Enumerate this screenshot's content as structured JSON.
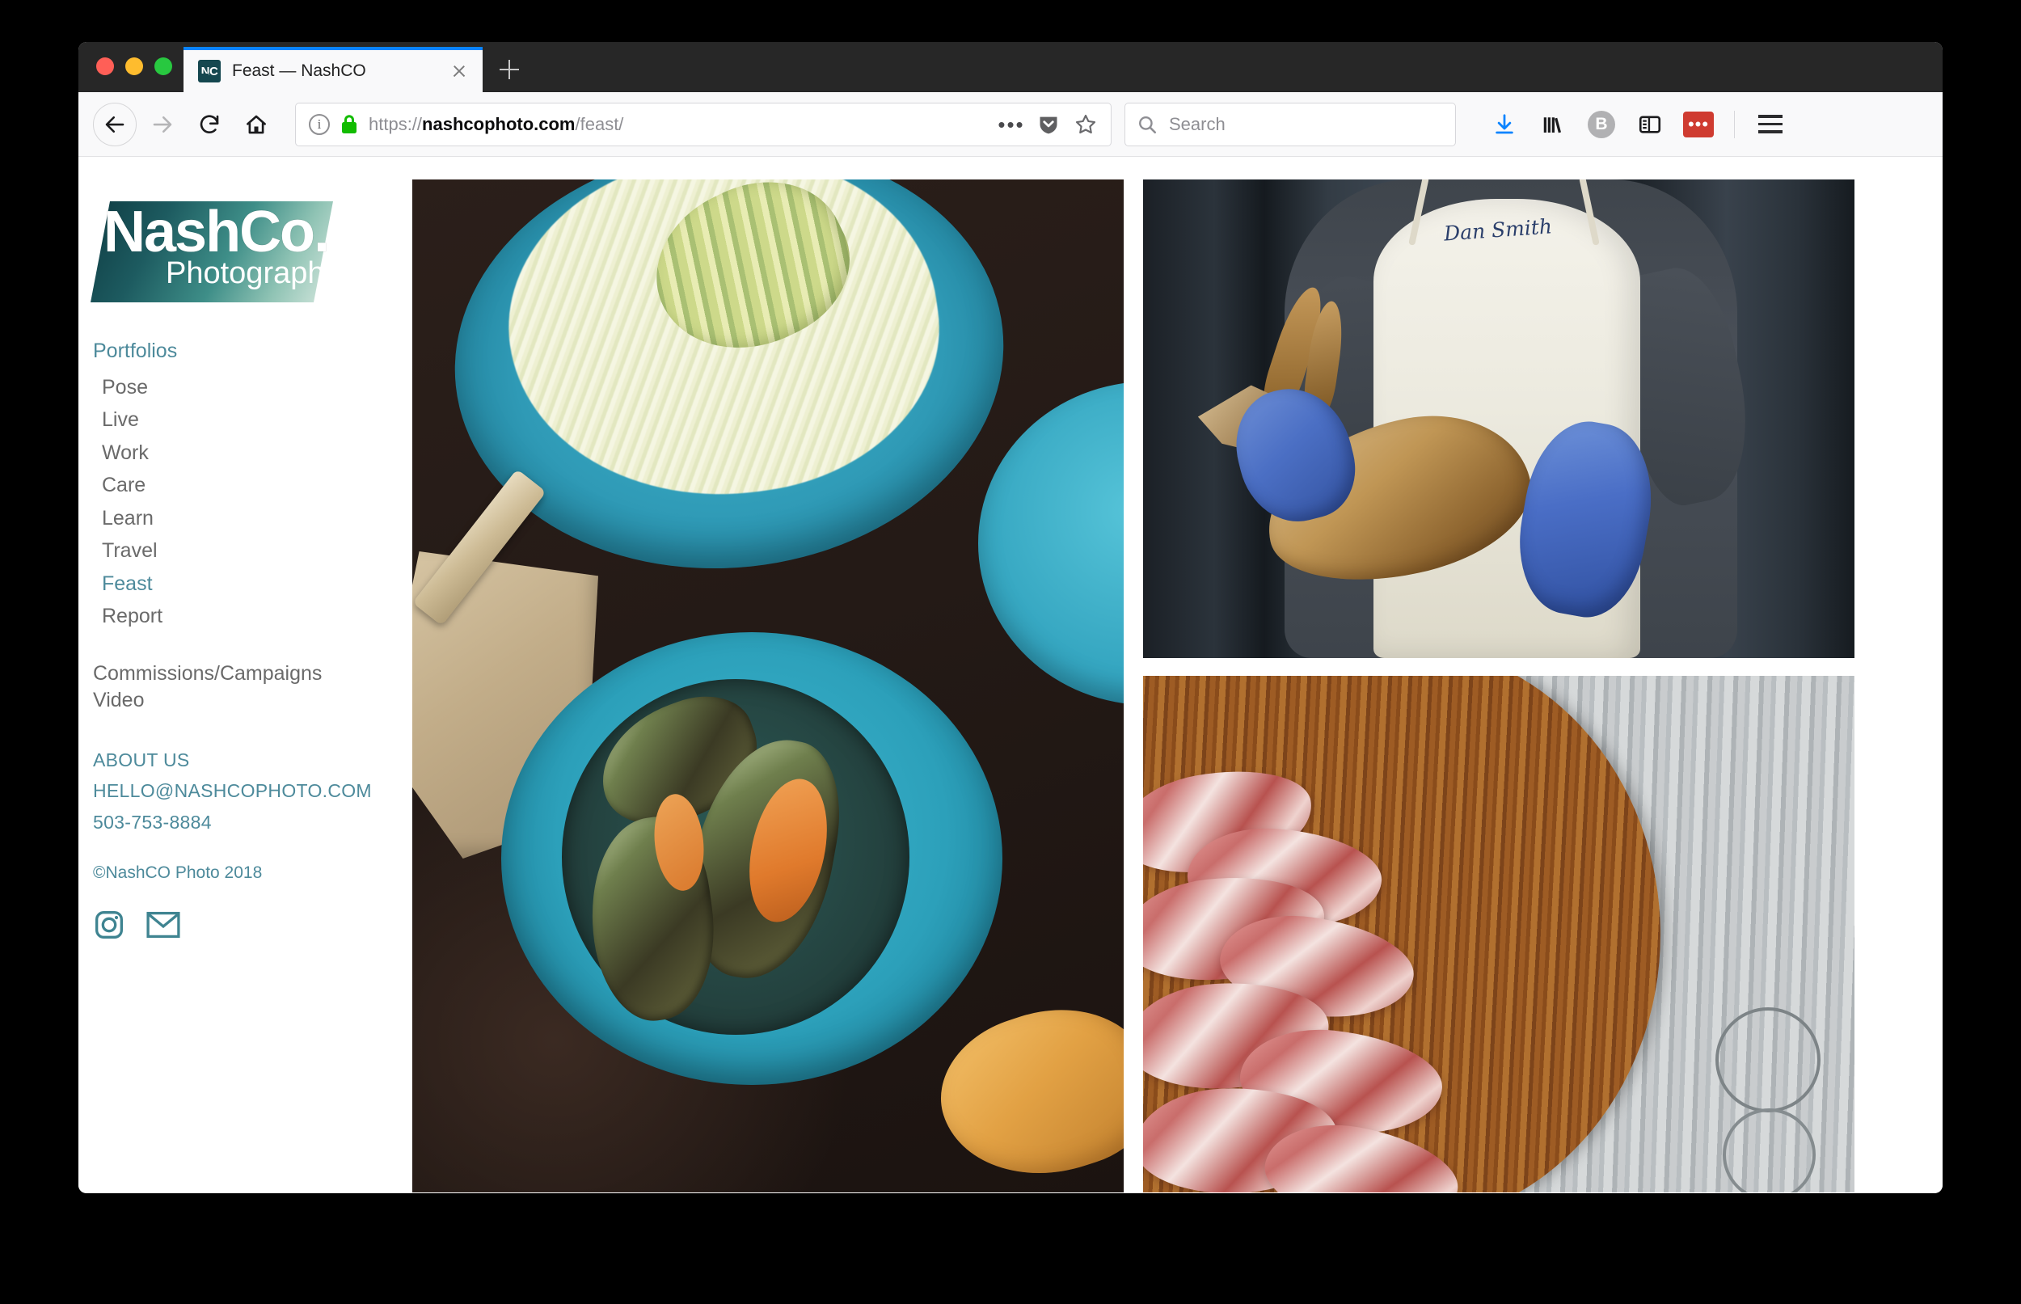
{
  "browser": {
    "tab": {
      "title": "Feast — NashCO",
      "favicon_label": "NC",
      "favicon_name": "nashco-favicon"
    },
    "new_tab_label": "+",
    "nav": {
      "back_label": "Back",
      "forward_label": "Forward",
      "reload_label": "Reload",
      "home_label": "Home"
    },
    "urlbar": {
      "scheme": "https://",
      "domain": "nashcophoto.com",
      "path": "/feast/",
      "info_label": "i",
      "security_state": "secure",
      "page_actions_label": "•••",
      "pocket_label": "Pocket",
      "bookmark_label": "Bookmark this page"
    },
    "search": {
      "placeholder": "Search"
    },
    "toolbar_right": {
      "downloads_label": "Downloads",
      "library_label": "Library",
      "container_badge_label": "B",
      "sidebar_label": "Sidebars",
      "extension_label": "•••",
      "menu_label": "Open menu"
    }
  },
  "site": {
    "logo": {
      "main": "NashCo.",
      "sub": "Photography"
    },
    "nav": {
      "heading": "Portfolios",
      "items": [
        {
          "label": "Pose",
          "active": false
        },
        {
          "label": "Live",
          "active": false
        },
        {
          "label": "Work",
          "active": false
        },
        {
          "label": "Care",
          "active": false
        },
        {
          "label": "Learn",
          "active": false
        },
        {
          "label": "Travel",
          "active": false
        },
        {
          "label": "Feast",
          "active": true
        },
        {
          "label": "Report",
          "active": false
        }
      ]
    },
    "secondary_links": [
      "Commissions/Campaigns",
      "Video"
    ],
    "contact": {
      "about": "ABOUT US",
      "email": "HELLO@NASHCOPHOTO.COM",
      "phone": "503-753-8884"
    },
    "copyright": "©NashCO Photo 2018",
    "social": [
      {
        "name": "instagram-icon",
        "label": "Instagram"
      },
      {
        "name": "email-icon",
        "label": "Email"
      }
    ],
    "gallery": {
      "photos": [
        {
          "name": "photo-seafood-bowls",
          "alt": "Teal bowls of shaved slaw with avocado and a pot of mussels on a dark table"
        },
        {
          "name": "photo-crab-handler",
          "alt": "Fishmonger in a white apron labeled Dan Smith holding a crab with blue gloves",
          "apron_name": "Dan Smith"
        },
        {
          "name": "photo-prosciutto-board",
          "alt": "Slices of prosciutto fanned on a round wooden board over weathered gray wood"
        }
      ]
    }
  },
  "colors": {
    "accent_teal": "#4d8a9b",
    "nav_gray": "#6a6a6a",
    "tab_active_bar": "#0a84ff",
    "download_blue": "#0a84ff",
    "extension_red": "#cf3b30",
    "chrome_dark": "#272727"
  }
}
